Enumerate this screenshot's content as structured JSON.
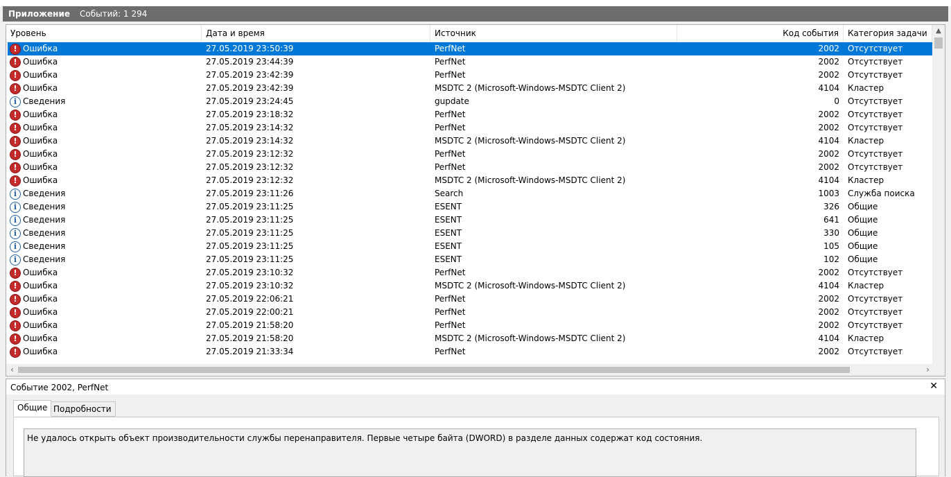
{
  "header": {
    "title": "Приложение",
    "count": "Событий: 1 294"
  },
  "columns": [
    "Уровень",
    "Дата и время",
    "Источник",
    "Код события",
    "Категория задачи"
  ],
  "rows": [
    {
      "level": "Ошибка",
      "type": "error",
      "date": "27.05.2019 23:50:39",
      "source": "PerfNet",
      "code": "2002",
      "category": "Отсутствует",
      "selected": true
    },
    {
      "level": "Ошибка",
      "type": "error",
      "date": "27.05.2019 23:44:39",
      "source": "PerfNet",
      "code": "2002",
      "category": "Отсутствует"
    },
    {
      "level": "Ошибка",
      "type": "error",
      "date": "27.05.2019 23:42:39",
      "source": "PerfNet",
      "code": "2002",
      "category": "Отсутствует"
    },
    {
      "level": "Ошибка",
      "type": "error",
      "date": "27.05.2019 23:42:39",
      "source": "MSDTC 2 (Microsoft-Windows-MSDTC Client 2)",
      "code": "4104",
      "category": "Кластер"
    },
    {
      "level": "Сведения",
      "type": "info",
      "date": "27.05.2019 23:24:45",
      "source": "gupdate",
      "code": "0",
      "category": "Отсутствует"
    },
    {
      "level": "Ошибка",
      "type": "error",
      "date": "27.05.2019 23:18:32",
      "source": "PerfNet",
      "code": "2002",
      "category": "Отсутствует"
    },
    {
      "level": "Ошибка",
      "type": "error",
      "date": "27.05.2019 23:14:32",
      "source": "PerfNet",
      "code": "2002",
      "category": "Отсутствует"
    },
    {
      "level": "Ошибка",
      "type": "error",
      "date": "27.05.2019 23:14:32",
      "source": "MSDTC 2 (Microsoft-Windows-MSDTC Client 2)",
      "code": "4104",
      "category": "Кластер"
    },
    {
      "level": "Ошибка",
      "type": "error",
      "date": "27.05.2019 23:12:32",
      "source": "PerfNet",
      "code": "2002",
      "category": "Отсутствует"
    },
    {
      "level": "Ошибка",
      "type": "error",
      "date": "27.05.2019 23:12:32",
      "source": "PerfNet",
      "code": "2002",
      "category": "Отсутствует"
    },
    {
      "level": "Ошибка",
      "type": "error",
      "date": "27.05.2019 23:12:32",
      "source": "MSDTC 2 (Microsoft-Windows-MSDTC Client 2)",
      "code": "4104",
      "category": "Кластер"
    },
    {
      "level": "Сведения",
      "type": "info",
      "date": "27.05.2019 23:11:26",
      "source": "Search",
      "code": "1003",
      "category": "Служба поиска"
    },
    {
      "level": "Сведения",
      "type": "info",
      "date": "27.05.2019 23:11:25",
      "source": "ESENT",
      "code": "326",
      "category": "Общие"
    },
    {
      "level": "Сведения",
      "type": "info",
      "date": "27.05.2019 23:11:25",
      "source": "ESENT",
      "code": "641",
      "category": "Общие"
    },
    {
      "level": "Сведения",
      "type": "info",
      "date": "27.05.2019 23:11:25",
      "source": "ESENT",
      "code": "330",
      "category": "Общие"
    },
    {
      "level": "Сведения",
      "type": "info",
      "date": "27.05.2019 23:11:25",
      "source": "ESENT",
      "code": "105",
      "category": "Общие"
    },
    {
      "level": "Сведения",
      "type": "info",
      "date": "27.05.2019 23:11:25",
      "source": "ESENT",
      "code": "102",
      "category": "Общие"
    },
    {
      "level": "Ошибка",
      "type": "error",
      "date": "27.05.2019 23:10:32",
      "source": "PerfNet",
      "code": "2002",
      "category": "Отсутствует"
    },
    {
      "level": "Ошибка",
      "type": "error",
      "date": "27.05.2019 23:10:32",
      "source": "MSDTC 2 (Microsoft-Windows-MSDTC Client 2)",
      "code": "4104",
      "category": "Кластер"
    },
    {
      "level": "Ошибка",
      "type": "error",
      "date": "27.05.2019 22:06:21",
      "source": "PerfNet",
      "code": "2002",
      "category": "Отсутствует"
    },
    {
      "level": "Ошибка",
      "type": "error",
      "date": "27.05.2019 22:00:21",
      "source": "PerfNet",
      "code": "2002",
      "category": "Отсутствует"
    },
    {
      "level": "Ошибка",
      "type": "error",
      "date": "27.05.2019 21:58:20",
      "source": "PerfNet",
      "code": "2002",
      "category": "Отсутствует"
    },
    {
      "level": "Ошибка",
      "type": "error",
      "date": "27.05.2019 21:58:20",
      "source": "MSDTC 2 (Microsoft-Windows-MSDTC Client 2)",
      "code": "4104",
      "category": "Кластер"
    },
    {
      "level": "Ошибка",
      "type": "error",
      "date": "27.05.2019 21:33:34",
      "source": "PerfNet",
      "code": "2002",
      "category": "Отсутствует"
    }
  ],
  "icons": {
    "error": "error-icon",
    "info": "info-icon"
  },
  "colors": {
    "selection": "#0078d7",
    "error": "#c42b2b",
    "info": "#1f5fa8",
    "header_bg": "#6d6d6d"
  },
  "detail": {
    "title": "Событие 2002, PerfNet",
    "close": "✕",
    "tabs": [
      "Общие",
      "Подробности"
    ],
    "active_tab": 0,
    "message": "Не удалось открыть объект производительности службы перенаправителя. Первые четыре байта (DWORD) в разделе данных содержат код состояния."
  }
}
